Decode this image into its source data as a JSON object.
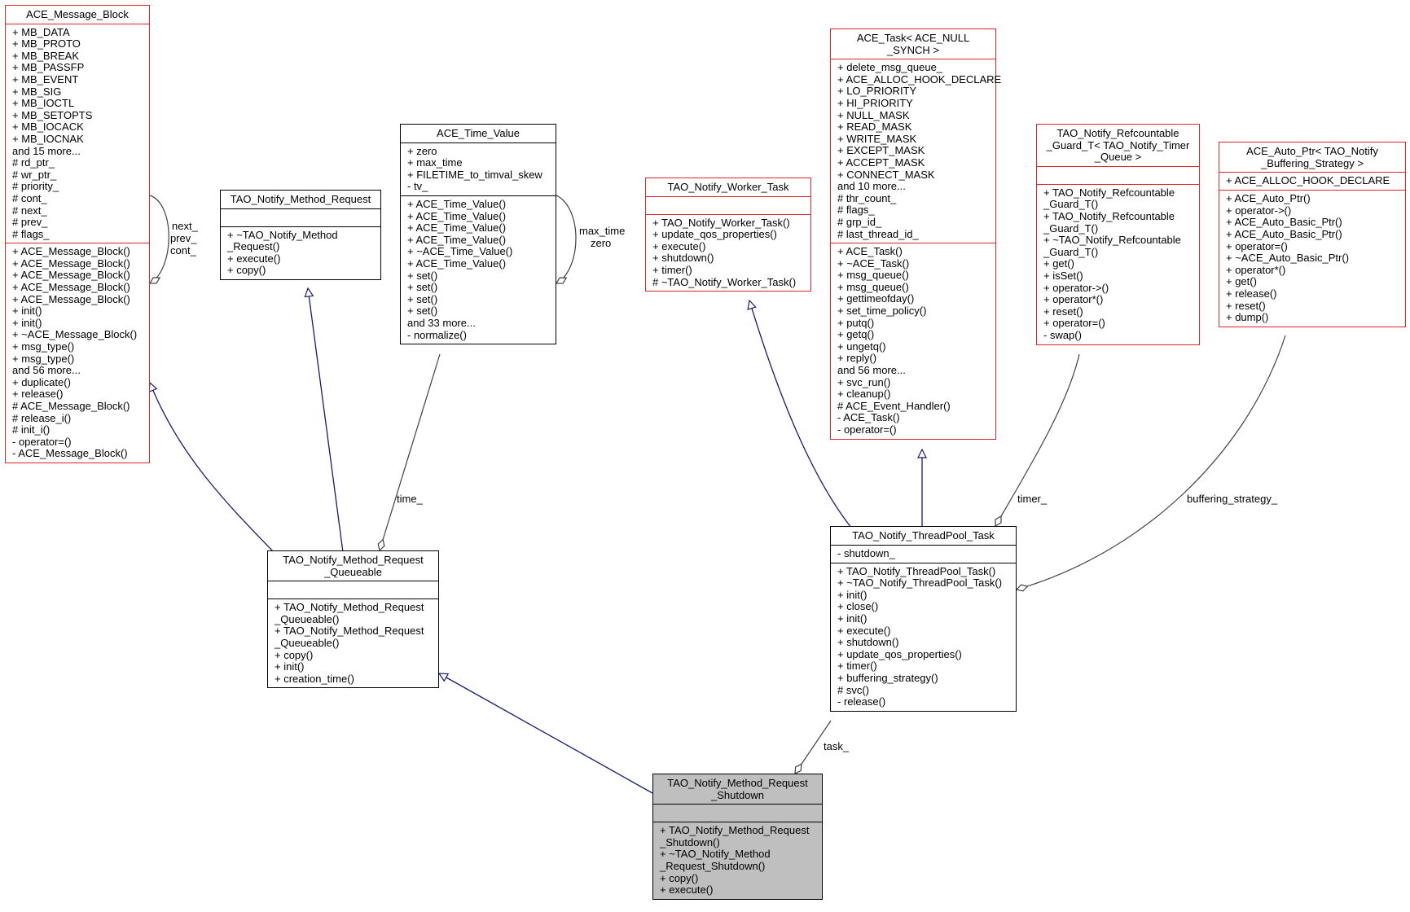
{
  "diagram": {
    "type": "class-collaboration-graph",
    "colors": {
      "inherit_edge": "#191970",
      "usage_edge": "#404040",
      "incomplete_border": "#e0262b",
      "complete_border": "#000000",
      "focus_fill": "#bfbfbf"
    },
    "classes": {
      "ace_message_block": {
        "title": "ACE_Message_Block",
        "attributes": [
          "+ MB_DATA",
          "+ MB_PROTO",
          "+ MB_BREAK",
          "+ MB_PASSFP",
          "+ MB_EVENT",
          "+ MB_SIG",
          "+ MB_IOCTL",
          "+ MB_SETOPTS",
          "+ MB_IOCACK",
          "+ MB_IOCNAK",
          "and 15 more...",
          "# rd_ptr_",
          "# wr_ptr_",
          "# priority_",
          "# cont_",
          "# next_",
          "# prev_",
          "# flags_"
        ],
        "methods": [
          "+ ACE_Message_Block()",
          "+ ACE_Message_Block()",
          "+ ACE_Message_Block()",
          "+ ACE_Message_Block()",
          "+ ACE_Message_Block()",
          "+ init()",
          "+ init()",
          "+ ~ACE_Message_Block()",
          "+ msg_type()",
          "+ msg_type()",
          "and 56 more...",
          "+ duplicate()",
          "+ release()",
          "# ACE_Message_Block()",
          "# release_i()",
          "# init_i()",
          "- operator=()",
          "- ACE_Message_Block()"
        ]
      },
      "tao_notify_method_request": {
        "title": "TAO_Notify_Method_Request",
        "attributes": [],
        "methods": [
          "+ ~TAO_Notify_Method\n_Request()",
          "+ execute()",
          "+ copy()"
        ]
      },
      "ace_time_value": {
        "title": "ACE_Time_Value",
        "attributes": [
          "+ zero",
          "+ max_time",
          "+ FILETIME_to_timval_skew",
          "- tv_"
        ],
        "methods": [
          "+ ACE_Time_Value()",
          "+ ACE_Time_Value()",
          "+ ACE_Time_Value()",
          "+ ACE_Time_Value()",
          "+ ~ACE_Time_Value()",
          "+ ACE_Time_Value()",
          "+ set()",
          "+ set()",
          "+ set()",
          "+ set()",
          "and 33 more...",
          "- normalize()"
        ]
      },
      "tao_notify_method_request_queueable": {
        "title": "TAO_Notify_Method_Request\n_Queueable",
        "attributes": [],
        "methods": [
          "+ TAO_Notify_Method_Request\n_Queueable()",
          "+ TAO_Notify_Method_Request\n_Queueable()",
          "+ copy()",
          "+ init()",
          "+ creation_time()"
        ]
      },
      "tao_notify_worker_task": {
        "title": "TAO_Notify_Worker_Task",
        "attributes": [],
        "methods": [
          "+ TAO_Notify_Worker_Task()",
          "+ update_qos_properties()",
          "+ execute()",
          "+ shutdown()",
          "+ timer()",
          "# ~TAO_Notify_Worker_Task()"
        ]
      },
      "ace_task": {
        "title": "ACE_Task< ACE_NULL\n_SYNCH >",
        "attributes": [
          "+ delete_msg_queue_",
          "+ ACE_ALLOC_HOOK_DECLARE",
          "+ LO_PRIORITY",
          "+ HI_PRIORITY",
          "+ NULL_MASK",
          "+ READ_MASK",
          "+ WRITE_MASK",
          "+ EXCEPT_MASK",
          "+ ACCEPT_MASK",
          "+ CONNECT_MASK",
          "and 10 more...",
          "# thr_count_",
          "# flags_",
          "# grp_id_",
          "# last_thread_id_"
        ],
        "methods": [
          "+ ACE_Task()",
          "+ ~ACE_Task()",
          "+ msg_queue()",
          "+ msg_queue()",
          "+ gettimeofday()",
          "+ set_time_policy()",
          "+ putq()",
          "+ getq()",
          "+ ungetq()",
          "+ reply()",
          "and 56 more...",
          "+ svc_run()",
          "+ cleanup()",
          "# ACE_Event_Handler()",
          "- ACE_Task()",
          "- operator=()"
        ]
      },
      "tao_notify_refcountable_guard": {
        "title": "TAO_Notify_Refcountable\n_Guard_T< TAO_Notify_Timer\n_Queue >",
        "attributes": [],
        "methods": [
          "+ TAO_Notify_Refcountable\n_Guard_T()",
          "+ TAO_Notify_Refcountable\n_Guard_T()",
          "+ ~TAO_Notify_Refcountable\n_Guard_T()",
          "+ get()",
          "+ isSet()",
          "+ operator->()",
          "+ operator*()",
          "+ reset()",
          "+ operator=()",
          "- swap()"
        ]
      },
      "ace_auto_ptr": {
        "title": "ACE_Auto_Ptr< TAO_Notify\n_Buffering_Strategy >",
        "attributes": [
          "+ ACE_ALLOC_HOOK_DECLARE"
        ],
        "methods": [
          "+ ACE_Auto_Ptr()",
          "+ operator->()",
          "+ ACE_Auto_Basic_Ptr()",
          "+ ACE_Auto_Basic_Ptr()",
          "+ operator=()",
          "+ ~ACE_Auto_Basic_Ptr()",
          "+ operator*()",
          "+ get()",
          "+ release()",
          "+ reset()",
          "+ dump()"
        ]
      },
      "tao_notify_threadpool_task": {
        "title": "TAO_Notify_ThreadPool_Task",
        "attributes": [
          "- shutdown_"
        ],
        "methods": [
          "+ TAO_Notify_ThreadPool_Task()",
          "+ ~TAO_Notify_ThreadPool_Task()",
          "+ init()",
          "+ close()",
          "+ init()",
          "+ execute()",
          "+ shutdown()",
          "+ update_qos_properties()",
          "+ timer()",
          "+ buffering_strategy()",
          "# svc()",
          "- release()"
        ]
      },
      "tao_notify_method_request_shutdown": {
        "title": "TAO_Notify_Method_Request\n_Shutdown",
        "attributes": [],
        "methods": [
          "+ TAO_Notify_Method_Request\n_Shutdown()",
          "+ ~TAO_Notify_Method\n_Request_Shutdown()",
          "+ copy()",
          "+ execute()"
        ]
      }
    },
    "edge_labels": {
      "self_message_block": "next_\nprev_\ncont_",
      "self_time_value": "max_time\nzero",
      "time": "time_",
      "timer": "timer_",
      "buffering_strategy": "buffering_strategy_",
      "task": "task_"
    }
  }
}
